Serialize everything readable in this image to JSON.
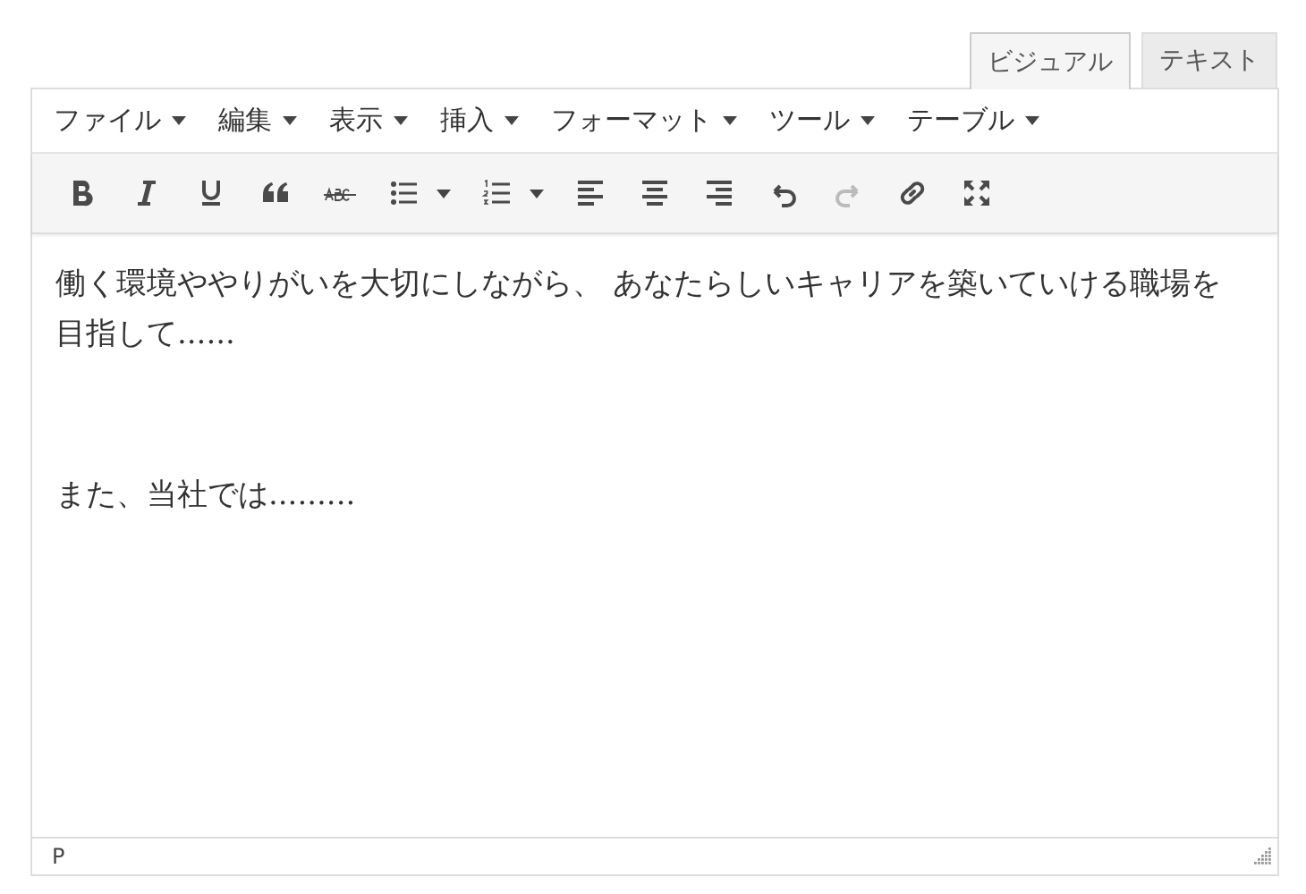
{
  "tabs": [
    {
      "label": "ビジュアル",
      "selected": true
    },
    {
      "label": "テキスト",
      "selected": false
    }
  ],
  "menubar": [
    {
      "label": "ファイル"
    },
    {
      "label": "編集"
    },
    {
      "label": "表示"
    },
    {
      "label": "挿入"
    },
    {
      "label": "フォーマット"
    },
    {
      "label": "ツール"
    },
    {
      "label": "テーブル"
    }
  ],
  "toolbar": [
    {
      "kind": "bold",
      "disabled": false
    },
    {
      "kind": "italic",
      "disabled": false
    },
    {
      "kind": "underline",
      "disabled": false
    },
    {
      "kind": "blockquote",
      "disabled": false
    },
    {
      "kind": "strikethrough",
      "disabled": false
    },
    {
      "kind": "bullist",
      "disabled": false,
      "dropdown": true
    },
    {
      "kind": "numlist",
      "disabled": false,
      "dropdown": true
    },
    {
      "kind": "alignleft",
      "disabled": false
    },
    {
      "kind": "aligncenter",
      "disabled": false
    },
    {
      "kind": "alignright",
      "disabled": false
    },
    {
      "kind": "undo",
      "disabled": false
    },
    {
      "kind": "redo",
      "disabled": true
    },
    {
      "kind": "link",
      "disabled": false
    },
    {
      "kind": "fullscreen",
      "disabled": false
    }
  ],
  "content": {
    "paragraphs": [
      "働く環境ややりがいを大切にしながら、 あなたらしいキャリアを築いていける職場を目指して......",
      "また、当社では........."
    ]
  },
  "status_bar": {
    "path": "P"
  }
}
